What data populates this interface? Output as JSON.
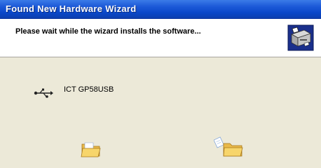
{
  "window": {
    "title": "Found New Hardware Wizard"
  },
  "header": {
    "message": "Please wait while the wizard installs the software...",
    "icon": "hardware-install-icon"
  },
  "device": {
    "icon": "usb-icon",
    "name": "ICT GP58USB"
  },
  "progress_animation": {
    "source_icon": "open-folder-icon",
    "target_icon": "folder-with-paper-icon"
  },
  "colors": {
    "titlebar": "#0a47c9",
    "background": "#ece9d8",
    "header_background": "#ffffff"
  }
}
